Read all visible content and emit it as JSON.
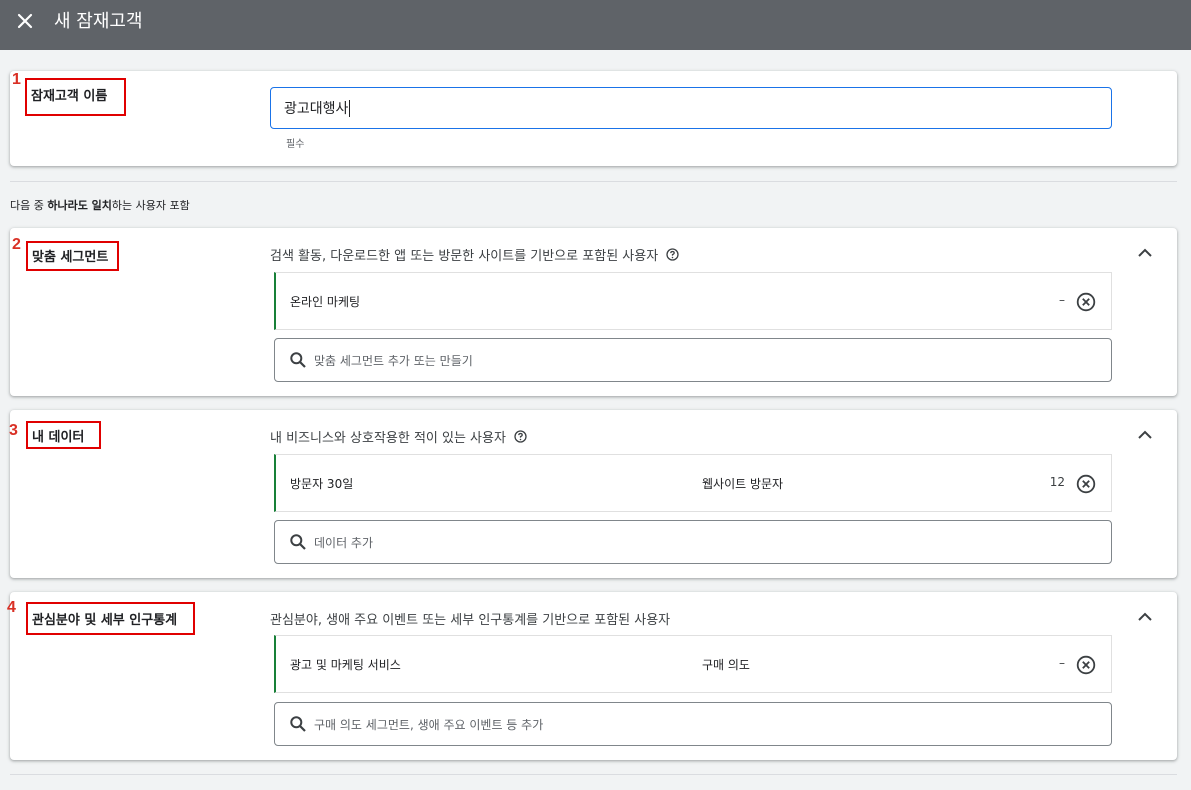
{
  "header": {
    "title": "새 잠재고객",
    "close_icon": "close-icon"
  },
  "audience_name": {
    "number": "1",
    "label": "잠재고객 이름",
    "value": "광고대행사",
    "hint": "필수"
  },
  "match_rule": {
    "prefix": "다음 중 ",
    "emphasis": "하나라도 일치",
    "suffix": "하는 사용자 포함"
  },
  "sections": [
    {
      "number": "2",
      "label": "맞춤 세그먼트",
      "description": "검색 활동, 다운로드한 앱 또는 방문한 사이트를 기반으로 포함된 사용자",
      "has_help": true,
      "item": {
        "name": "온라인 마케팅",
        "type": "",
        "count": "–"
      },
      "search_placeholder": "맞춤 세그먼트 추가 또는 만들기"
    },
    {
      "number": "3",
      "label": "내 데이터",
      "description": "내 비즈니스와 상호작용한 적이 있는 사용자",
      "has_help": true,
      "item": {
        "name": "방문자 30일",
        "type": "웹사이트 방문자",
        "count": "12"
      },
      "search_placeholder": "데이터 추가"
    },
    {
      "number": "4",
      "label": "관심분야 및 세부 인구통계",
      "description": "관심분야, 생애 주요 이벤트 또는 세부 인구통계를 기반으로 포함된 사용자",
      "has_help": false,
      "item": {
        "name": "광고 및 마케팅 서비스",
        "type": "구매 의도",
        "count": "–"
      },
      "search_placeholder": "구매 의도 세그먼트, 생애 주요 이벤트 등 추가"
    }
  ],
  "colors": {
    "header_bg": "#5f6368",
    "annotation_red": "#e00000",
    "focus_blue": "#1a73e8",
    "item_accent_green": "#188038"
  }
}
